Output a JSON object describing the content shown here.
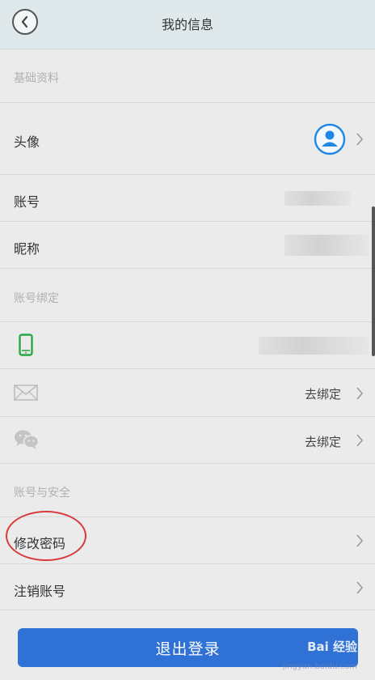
{
  "header": {
    "title": "我的信息"
  },
  "sections": {
    "basic": "基础资料",
    "binding": "账号绑定",
    "security": "账号与安全"
  },
  "rows": {
    "avatar": {
      "label": "头像"
    },
    "account": {
      "label": "账号"
    },
    "nickname": {
      "label": "昵称"
    },
    "email": {
      "value": "去绑定"
    },
    "wechat": {
      "value": "去绑定"
    },
    "change_password": {
      "label": "修改密码"
    },
    "cancel_account": {
      "label": "注销账号"
    }
  },
  "logout": {
    "label": "退出登录"
  },
  "watermark": {
    "brand": "Bai 经验",
    "url": "jingyan.baidu.com"
  },
  "icons": {
    "back": "chevron-left-icon",
    "avatar": "user-circle-icon",
    "phone": "phone-icon",
    "email": "envelope-icon",
    "wechat": "wechat-icon",
    "chevron": "chevron-right-icon"
  },
  "colors": {
    "accent": "#2f71d4",
    "avatar_blue": "#1e88e5",
    "phone_green": "#2aa845",
    "annotation_red": "#d83a3a"
  }
}
